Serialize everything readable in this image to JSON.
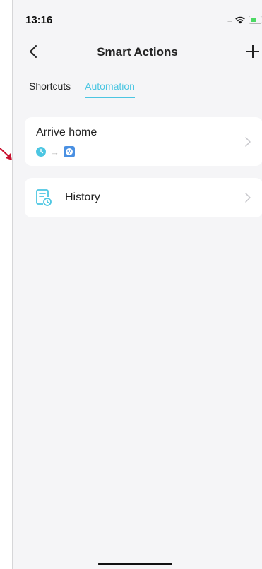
{
  "status_bar": {
    "time": "13:16",
    "signal_dots": "....."
  },
  "nav": {
    "title": "Smart Actions",
    "back_icon": "chevron-left-icon",
    "add_icon": "plus-icon"
  },
  "tabs": [
    {
      "label": "Shortcuts",
      "active": false
    },
    {
      "label": "Automation",
      "active": true
    }
  ],
  "automations": [
    {
      "name": "Arrive home",
      "trigger_icon": "clock-icon",
      "arrow": "→",
      "action_icon": "smart-plug-icon"
    }
  ],
  "history": {
    "label": "History",
    "icon": "history-document-icon"
  },
  "colors": {
    "accent": "#4cc6e2",
    "background": "#f5f5f7",
    "card": "#ffffff",
    "text": "#222222",
    "battery": "#4cd964",
    "annotation_arrow": "#c8102e"
  }
}
